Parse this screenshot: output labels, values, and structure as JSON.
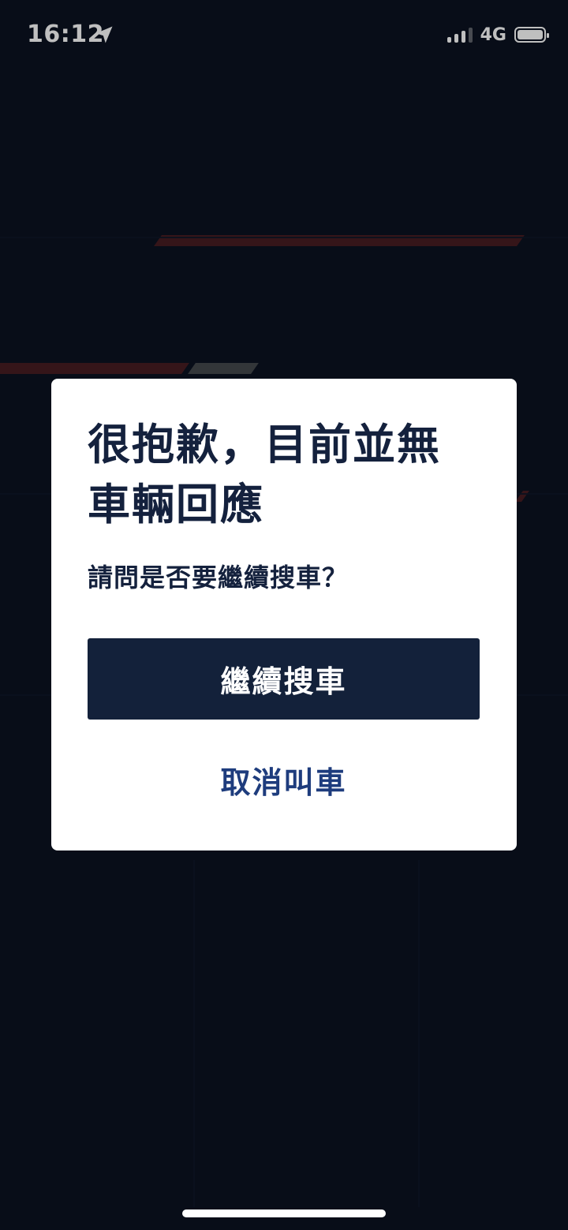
{
  "status_bar": {
    "time": "16:12",
    "network": "4G",
    "location_icon": "location-arrow-icon",
    "signal_bars_active": 3,
    "battery_level": 1.0
  },
  "dialog": {
    "title": "很抱歉，目前並無車輛回應",
    "subtitle": "請問是否要繼續搜車？",
    "primary_button": "繼續搜車",
    "secondary_button": "取消叫車"
  },
  "colors": {
    "background": "#0b1220",
    "dialog": "#ffffff",
    "title_text": "#14213d",
    "primary_button": "#13213a",
    "secondary_text": "#1e3c7d",
    "accent_red": "#7a2424"
  }
}
